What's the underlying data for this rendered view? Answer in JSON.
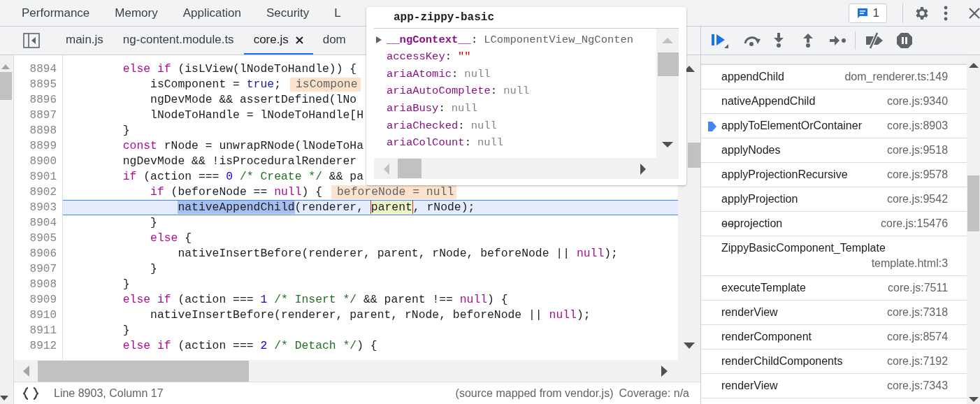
{
  "main_tabs": [
    {
      "label": "Performance",
      "selected": false
    },
    {
      "label": "Memory",
      "selected": false
    },
    {
      "label": "Application",
      "selected": false
    },
    {
      "label": "Security",
      "selected": false
    },
    {
      "label": "L",
      "selected": false
    }
  ],
  "issues_count": "1",
  "file_tabs": [
    {
      "label": "main.js",
      "selected": false,
      "closable": false
    },
    {
      "label": "ng-content.module.ts",
      "selected": false,
      "closable": false
    },
    {
      "label": "core.js",
      "selected": true,
      "closable": true
    },
    {
      "label": "dom",
      "selected": false,
      "closable": false
    }
  ],
  "editor": {
    "lines": [
      {
        "number": "8894",
        "current": false,
        "tokens": [
          {
            "text": "        else if",
            "kind": "keyword"
          },
          {
            "text": " (isLView(lNodeToHandle)) {",
            "kind": "plain"
          }
        ]
      },
      {
        "number": "8895",
        "current": false,
        "tokens": [
          {
            "text": "            isComponent = ",
            "kind": "plain"
          },
          {
            "text": "true",
            "kind": "atom"
          },
          {
            "text": ";",
            "kind": "plain"
          }
        ],
        "inline_value": "isCompone"
      },
      {
        "number": "8896",
        "current": false,
        "tokens": [
          {
            "text": "            ngDevMode && assertDefined(lNo",
            "kind": "plain"
          }
        ]
      },
      {
        "number": "8897",
        "current": false,
        "tokens": [
          {
            "text": "            lNodeToHandle = lNodeToHandle[H",
            "kind": "plain"
          }
        ]
      },
      {
        "number": "8898",
        "current": false,
        "tokens": [
          {
            "text": "        }",
            "kind": "plain"
          }
        ]
      },
      {
        "number": "8899",
        "current": false,
        "tokens": [
          {
            "text": "        const",
            "kind": "keyword"
          },
          {
            "text": " rNode = unwrapRNode(lNodeToHa",
            "kind": "plain"
          }
        ]
      },
      {
        "number": "8900",
        "current": false,
        "tokens": [
          {
            "text": "        ngDevMode && !isProceduralRenderer",
            "kind": "plain"
          }
        ]
      },
      {
        "number": "8901",
        "current": false,
        "tokens": [
          {
            "text": "        if",
            "kind": "keyword"
          },
          {
            "text": " (action === ",
            "kind": "plain"
          },
          {
            "text": "0",
            "kind": "number"
          },
          {
            "text": " /* Create */",
            "kind": "comment"
          },
          {
            "text": " && pa",
            "kind": "plain"
          }
        ]
      },
      {
        "number": "8902",
        "current": false,
        "tokens": [
          {
            "text": "            if",
            "kind": "keyword"
          },
          {
            "text": " (beforeNode == ",
            "kind": "plain"
          },
          {
            "text": "null",
            "kind": "keyword"
          },
          {
            "text": ") {",
            "kind": "plain"
          }
        ],
        "inline_value": "beforeNode = null"
      },
      {
        "number": "8903",
        "current": true,
        "tokens": [
          {
            "text": "                nativeAppendChild",
            "kind": "selection"
          },
          {
            "text": "(renderer, ",
            "kind": "plain"
          },
          {
            "text": "parent",
            "kind": "hovered"
          },
          {
            "text": ", rNode);",
            "kind": "plain"
          }
        ]
      },
      {
        "number": "8904",
        "current": false,
        "tokens": [
          {
            "text": "            }",
            "kind": "plain"
          }
        ]
      },
      {
        "number": "8905",
        "current": false,
        "tokens": [
          {
            "text": "            else",
            "kind": "keyword"
          },
          {
            "text": " {",
            "kind": "plain"
          }
        ]
      },
      {
        "number": "8906",
        "current": false,
        "tokens": [
          {
            "text": "                nativeInsertBefore(renderer, parent, rNode, beforeNode || ",
            "kind": "plain"
          },
          {
            "text": "null",
            "kind": "keyword"
          },
          {
            "text": ");",
            "kind": "plain"
          }
        ]
      },
      {
        "number": "8907",
        "current": false,
        "tokens": [
          {
            "text": "            }",
            "kind": "plain"
          }
        ]
      },
      {
        "number": "8908",
        "current": false,
        "tokens": [
          {
            "text": "        }",
            "kind": "plain"
          }
        ]
      },
      {
        "number": "8909",
        "current": false,
        "tokens": [
          {
            "text": "        else if",
            "kind": "keyword"
          },
          {
            "text": " (action === ",
            "kind": "plain"
          },
          {
            "text": "1",
            "kind": "number"
          },
          {
            "text": " /* Insert */",
            "kind": "comment"
          },
          {
            "text": " && parent !== ",
            "kind": "plain"
          },
          {
            "text": "null",
            "kind": "keyword"
          },
          {
            "text": ") {",
            "kind": "plain"
          }
        ]
      },
      {
        "number": "8910",
        "current": false,
        "tokens": [
          {
            "text": "            nativeInsertBefore(renderer, parent, rNode, beforeNode || ",
            "kind": "plain"
          },
          {
            "text": "null",
            "kind": "keyword"
          },
          {
            "text": ");",
            "kind": "plain"
          }
        ]
      },
      {
        "number": "8911",
        "current": false,
        "tokens": [
          {
            "text": "        }",
            "kind": "plain"
          }
        ]
      },
      {
        "number": "8912",
        "current": false,
        "tokens": [
          {
            "text": "        else if",
            "kind": "keyword"
          },
          {
            "text": " (action === ",
            "kind": "plain"
          },
          {
            "text": "2",
            "kind": "number"
          },
          {
            "text": " /* Detach */",
            "kind": "comment"
          },
          {
            "text": ") {",
            "kind": "plain"
          }
        ]
      }
    ]
  },
  "popover": {
    "title": "app-zippy-basic",
    "properties": [
      {
        "name": "__ngContext__",
        "separator": ":",
        "value": "LComponentView_NgConten",
        "kind": "object",
        "expandable": true
      },
      {
        "name": "accessKey",
        "separator": ":",
        "value": "\"\"",
        "kind": "string",
        "expandable": false
      },
      {
        "name": "ariaAtomic",
        "separator": ":",
        "value": "null",
        "kind": "null",
        "expandable": false
      },
      {
        "name": "ariaAutoComplete",
        "separator": ":",
        "value": "null",
        "kind": "null",
        "expandable": false
      },
      {
        "name": "ariaBusy",
        "separator": ":",
        "value": "null",
        "kind": "null",
        "expandable": false
      },
      {
        "name": "ariaChecked",
        "separator": ":",
        "value": "null",
        "kind": "null",
        "expandable": false
      },
      {
        "name": "ariaColCount",
        "separator": ":",
        "value": "null",
        "kind": "null",
        "expandable": false
      }
    ]
  },
  "call_stack": [
    {
      "name": "appendChild",
      "location": "dom_renderer.ts:149",
      "selected": false
    },
    {
      "name": "nativeAppendChild",
      "location": "core.js:9340",
      "selected": false
    },
    {
      "name": "applyToElementOrContainer",
      "location": "core.js:8903",
      "selected": true
    },
    {
      "name": "applyNodes",
      "location": "core.js:9518",
      "selected": false
    },
    {
      "name": "applyProjectionRecursive",
      "location": "core.js:9578",
      "selected": false
    },
    {
      "name": "applyProjection",
      "location": "core.js:9542",
      "selected": false
    },
    {
      "name": "ɵɵprojection",
      "location": "core.js:15476",
      "selected": false
    },
    {
      "name": "ZippyBasicComponent_Template",
      "location": "template.html:3",
      "selected": false
    },
    {
      "name": "executeTemplate",
      "location": "core.js:7511",
      "selected": false
    },
    {
      "name": "renderView",
      "location": "core.js:7318",
      "selected": false
    },
    {
      "name": "renderComponent",
      "location": "core.js:8574",
      "selected": false
    },
    {
      "name": "renderChildComponents",
      "location": "core.js:7192",
      "selected": false
    },
    {
      "name": "renderView",
      "location": "core.js:7343",
      "selected": false
    }
  ],
  "status_bar": {
    "position": "Line 8903, Column 17",
    "source_map": "(source mapped from vendor.js)",
    "coverage": "Coverage: n/a"
  }
}
